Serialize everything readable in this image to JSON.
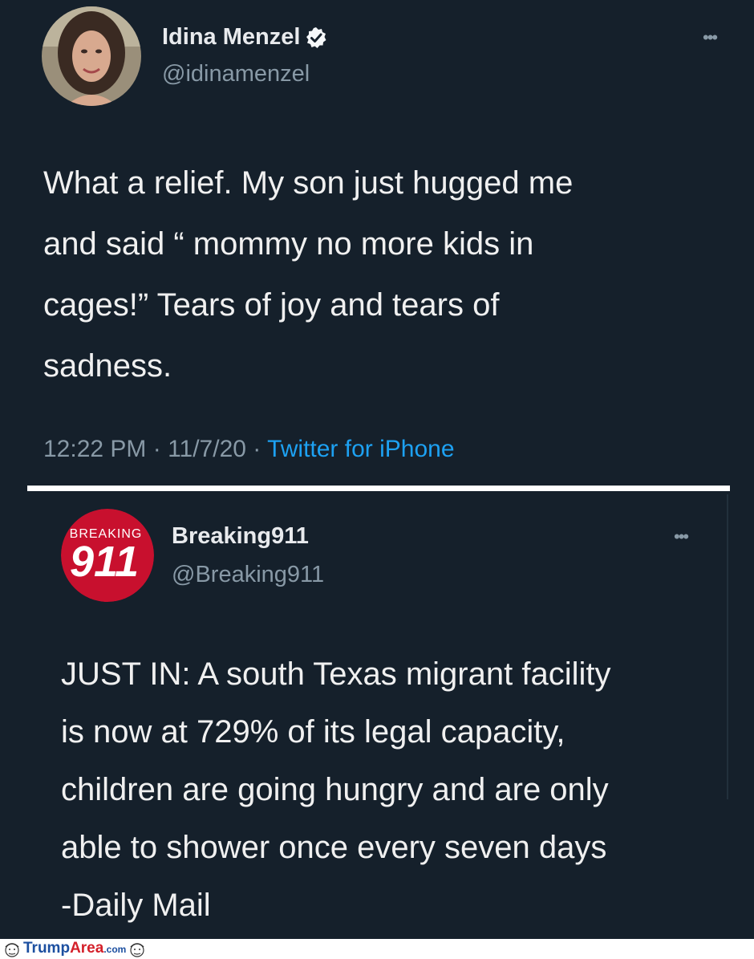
{
  "tweet": {
    "author_name": "Idina Menzel",
    "author_handle": "@idinamenzel",
    "verified": true,
    "more_icon": "more-options-icon",
    "text": "What a relief.  My son just hugged me\nand said “ mommy no more kids in\ncages!” Tears of joy and tears of\nsadness.",
    "time": "12:22 PM · 11/7/20 · ",
    "source": "Twitter for iPhone"
  },
  "quoted_tweet": {
    "author_name": "Breaking911",
    "author_handle": "@Breaking911",
    "avatar_logo_text": "BREAKING 911",
    "more_icon": "more-options-icon",
    "text": "JUST IN: A south Texas migrant facility\nis now at 729% of its legal capacity,\nchildren are going hungry and are only\nable to shower once every seven days\n-Daily Mail"
  },
  "watermark": {
    "part1": "Trump",
    "part2": "Area",
    "part3": ".com"
  },
  "colors": {
    "background": "#15202b",
    "link": "#1da1f2",
    "secondary_text": "#8899a6",
    "primary_text": "#f0f0f0"
  }
}
